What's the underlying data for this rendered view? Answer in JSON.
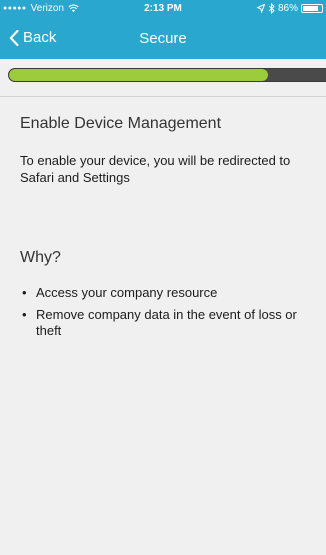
{
  "status_bar": {
    "carrier": "Verizon",
    "time": "2:13 PM",
    "battery": "86%",
    "battery_level": 0.86
  },
  "nav": {
    "back_label": "Back",
    "title": "Secure"
  },
  "progress": {
    "value": 0.79
  },
  "main": {
    "heading": "Enable Device Management",
    "description": "To enable your device, you will be redirected to Safari and Settings",
    "why_title": "Why?",
    "reasons": [
      "Access your company resource",
      "Remove company data in the event of loss or theft"
    ]
  },
  "colors": {
    "header": "#29a7cf",
    "progress_fill": "#9ccb3b",
    "progress_track": "#4a4a4a",
    "background": "#f0f0f1"
  },
  "icons": {
    "back": "chevron-left-icon",
    "wifi": "wifi-icon",
    "location": "location-arrow-icon",
    "bluetooth": "bluetooth-icon",
    "battery": "battery-icon"
  }
}
